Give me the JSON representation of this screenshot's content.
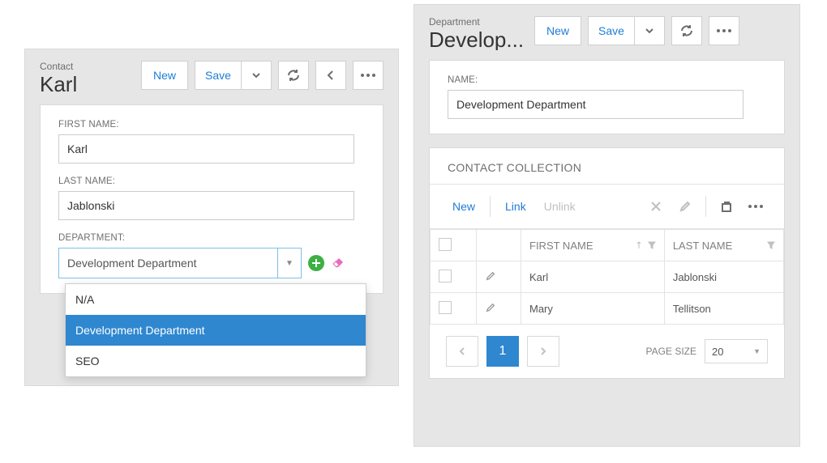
{
  "left": {
    "header_small": "Contact",
    "header_big": "Karl",
    "new_label": "New",
    "save_label": "Save",
    "fields": {
      "first_name_label": "FIRST NAME:",
      "first_name_value": "Karl",
      "last_name_label": "LAST NAME:",
      "last_name_value": "Jablonski",
      "department_label": "DEPARTMENT:",
      "department_value": "Development Department"
    },
    "dropdown": {
      "items": [
        {
          "label": "N/A"
        },
        {
          "label": "Development Department"
        },
        {
          "label": "SEO"
        }
      ],
      "selected_index": 1
    }
  },
  "right": {
    "header_small": "Department",
    "header_big": "Develop...",
    "new_label": "New",
    "save_label": "Save",
    "name_label": "NAME:",
    "name_value": "Development Department",
    "collection_title": "CONTACT COLLECTION",
    "toolbar": {
      "new": "New",
      "link": "Link",
      "unlink": "Unlink"
    },
    "columns": {
      "first": "FIRST NAME",
      "last": "LAST NAME"
    },
    "rows": [
      {
        "first": "Karl",
        "last": "Jablonski"
      },
      {
        "first": "Mary",
        "last": "Tellitson"
      }
    ],
    "pager": {
      "page": "1",
      "size_label": "PAGE SIZE",
      "size_value": "20"
    }
  }
}
